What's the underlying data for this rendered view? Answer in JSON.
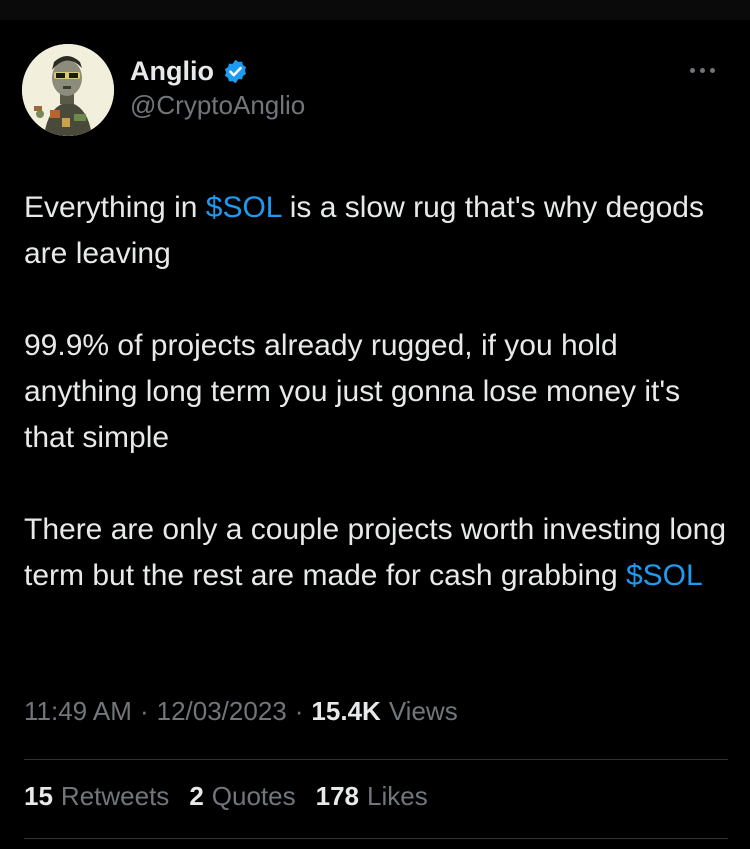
{
  "author": {
    "display_name": "Anglio",
    "handle": "@CryptoAnglio",
    "verified_icon": "verified-badge-icon",
    "avatar_icon": "avatar-image"
  },
  "tweet": {
    "p1_a": "Everything in ",
    "p1_link": "$SOL",
    "p1_b": " is a slow rug that's why degods are leaving",
    "p2": "99.9% of projects already rugged, if you hold anything long term you just gonna lose money it's that simple",
    "p3_a": "There are only a couple projects worth investing long term but the rest are made for cash grabbing ",
    "p3_link": "$SOL"
  },
  "meta": {
    "time": "11:49 AM",
    "separator": "·",
    "date": "12/03/2023",
    "views_count": "15.4K",
    "views_label": "Views"
  },
  "stats": {
    "retweets_count": "15",
    "retweets_label": "Retweets",
    "quotes_count": "2",
    "quotes_label": "Quotes",
    "likes_count": "178",
    "likes_label": "Likes"
  },
  "colors": {
    "background": "#000000",
    "text": "#e7e9ea",
    "muted": "#71767b",
    "accent": "#1d9bf0",
    "divider": "#2f3336"
  }
}
